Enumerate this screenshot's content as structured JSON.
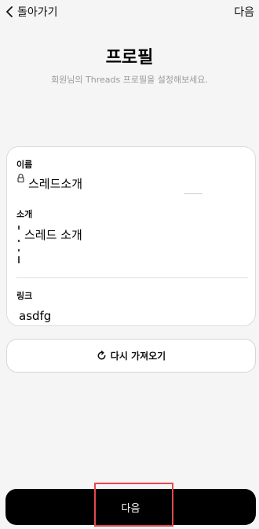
{
  "topbar": {
    "back_label": "돌아가기",
    "next_label": "다음"
  },
  "header": {
    "title": "프로필",
    "subtitle": "회원님의 Threads 프로필을 설정해보세요."
  },
  "profile": {
    "name_label": "이름",
    "name_value": "스레드소개",
    "bio_label": "소개",
    "bio_value": "스레드 소개",
    "link_label": "링크",
    "link_value": "asdfg"
  },
  "refresh_button": {
    "label": "다시 가져오기"
  },
  "footer": {
    "next_label": "다음"
  },
  "colors": {
    "background": "#f5f5f5",
    "primary_button": "#000000",
    "highlight_border": "#e5484d",
    "subtitle_text": "#9a9a9a"
  }
}
